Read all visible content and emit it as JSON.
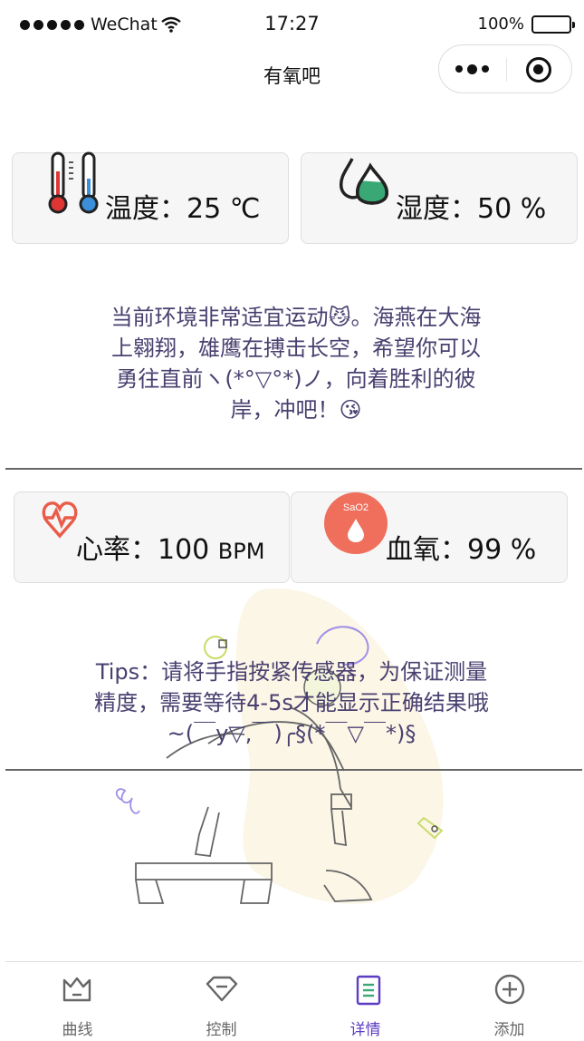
{
  "status_bar": {
    "carrier": "WeChat",
    "time": "17:27",
    "battery": "100%"
  },
  "nav": {
    "title": "有氧吧"
  },
  "environment": {
    "temperature_text": "温度：25 ℃",
    "humidity_text": "湿度：50 %",
    "message": "当前环境非常适宜运动😼。海燕在大海上翱翔，雄鹰在搏击长空，希望你可以勇往直前ヽ(*°▽°*)ノ，向着胜利的彼岸，冲吧！😘"
  },
  "vitals": {
    "heart_rate_label": "心率：100 ",
    "heart_rate_unit": "BPM",
    "spo2_badge": "SaO2",
    "spo2_text": "血氧：99 %",
    "tips": "Tips：请将手指按紧传感器，为保证测量精度，需要等待4-5s才能显示正确结果哦~(￣y▽,￣)╭§(*￣▽￣*)§"
  },
  "tabbar": {
    "active": "详情",
    "items": [
      {
        "label": "曲线",
        "icon": "crown-icon"
      },
      {
        "label": "控制",
        "icon": "diamond-icon"
      },
      {
        "label": "详情",
        "icon": "document-icon"
      },
      {
        "label": "添加",
        "icon": "plus-circle-icon"
      }
    ]
  },
  "colors": {
    "accent": "#5b3cc4",
    "message_text": "#4a4070",
    "spo2_badge": "#ef6f5c",
    "humidity_drop": "#3aa875"
  }
}
